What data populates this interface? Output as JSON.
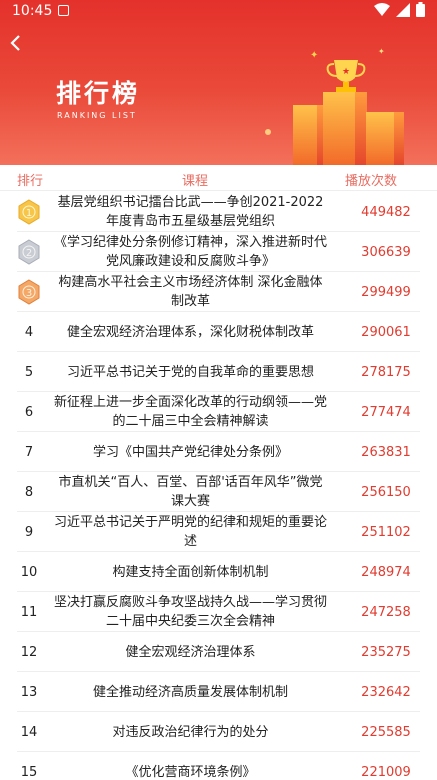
{
  "status": {
    "time": "10:45"
  },
  "header": {
    "title": "排行榜",
    "subtitle": "RANKING LIST"
  },
  "table": {
    "columns": {
      "rank": "排行",
      "course": "课程",
      "plays": "播放次数"
    },
    "rows": [
      {
        "rank": "1",
        "medal": "gold",
        "course": "基层党组织书记擂台比武——争创2021-2022年度青岛市五星级基层党组织",
        "plays": "449482"
      },
      {
        "rank": "2",
        "medal": "silver",
        "course": "《学习纪律处分条例修订精神，深入推进新时代党风廉政建设和反腐败斗争》",
        "plays": "306639"
      },
      {
        "rank": "3",
        "medal": "bronze",
        "course": "构建高水平社会主义市场经济体制 深化金融体制改革",
        "plays": "299499"
      },
      {
        "rank": "4",
        "course": "健全宏观经济治理体系，深化财税体制改革",
        "plays": "290061"
      },
      {
        "rank": "5",
        "course": "习近平总书记关于党的自我革命的重要思想",
        "plays": "278175"
      },
      {
        "rank": "6",
        "course": "新征程上进一步全面深化改革的行动纲领——党的二十届三中全会精神解读",
        "plays": "277474"
      },
      {
        "rank": "7",
        "course": "学习《中国共产党纪律处分条例》",
        "plays": "263831"
      },
      {
        "rank": "8",
        "course": "市直机关“百人、百堂、百部'话百年风华”微党课大赛",
        "plays": "256150"
      },
      {
        "rank": "9",
        "course": "习近平总书记关于严明党的纪律和规矩的重要论述",
        "plays": "251102"
      },
      {
        "rank": "10",
        "course": "构建支持全面创新体制机制",
        "plays": "248974"
      },
      {
        "rank": "11",
        "course": "坚决打赢反腐败斗争攻坚战持久战——学习贯彻二十届中央纪委三次全会精神",
        "plays": "247258"
      },
      {
        "rank": "12",
        "course": "健全宏观经济治理体系",
        "plays": "235275"
      },
      {
        "rank": "13",
        "course": "健全推动经济高质量发展体制机制",
        "plays": "232642"
      },
      {
        "rank": "14",
        "course": "对违反政治纪律行为的处分",
        "plays": "225585"
      },
      {
        "rank": "15",
        "course": "《优化营商环境条例》",
        "plays": "221009"
      }
    ]
  },
  "colors": {
    "header_red": "#e4312b",
    "play_count": "#e23b2f",
    "column_header": "#e86d61"
  },
  "icons": [
    "back-arrow-icon",
    "trophy-icon",
    "gold-medal-icon",
    "silver-medal-icon",
    "bronze-medal-icon",
    "wifi-icon",
    "signal-icon",
    "battery-icon"
  ]
}
